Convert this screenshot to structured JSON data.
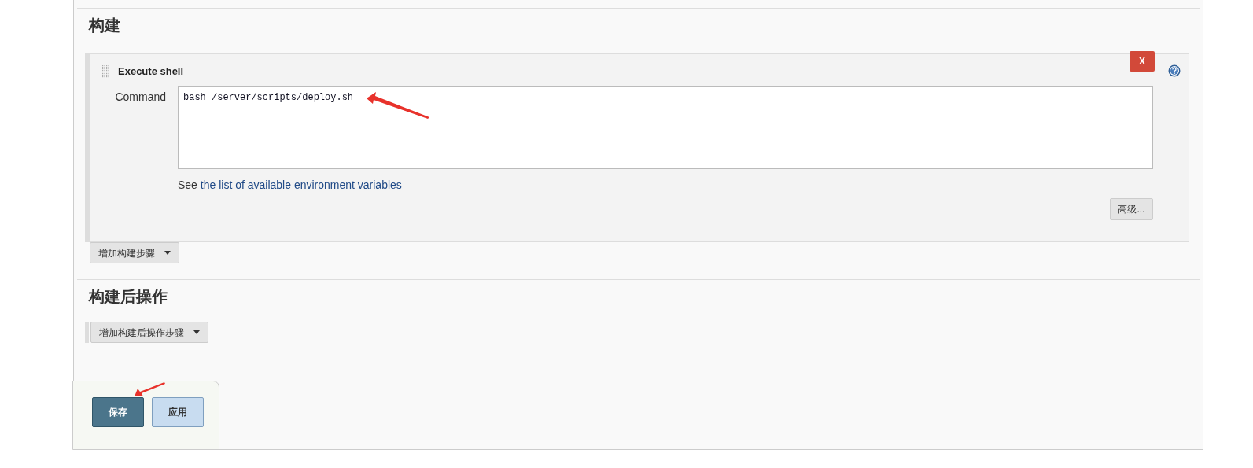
{
  "build": {
    "title": "构建",
    "step": {
      "title": "Execute shell",
      "delete_label": "X",
      "field_label": "Command",
      "command": "bash /server/scripts/deploy.sh",
      "hint_prefix": "See",
      "hint_link": "the list of available environment variables",
      "advanced_button": "高级..."
    },
    "add_button": "增加构建步骤"
  },
  "post_build": {
    "title": "构建后操作",
    "add_button": "增加构建后操作步骤"
  },
  "footer": {
    "buttons": [
      {
        "label": "保存",
        "kind": "primary"
      },
      {
        "label": "应用",
        "kind": "secondary"
      }
    ]
  }
}
